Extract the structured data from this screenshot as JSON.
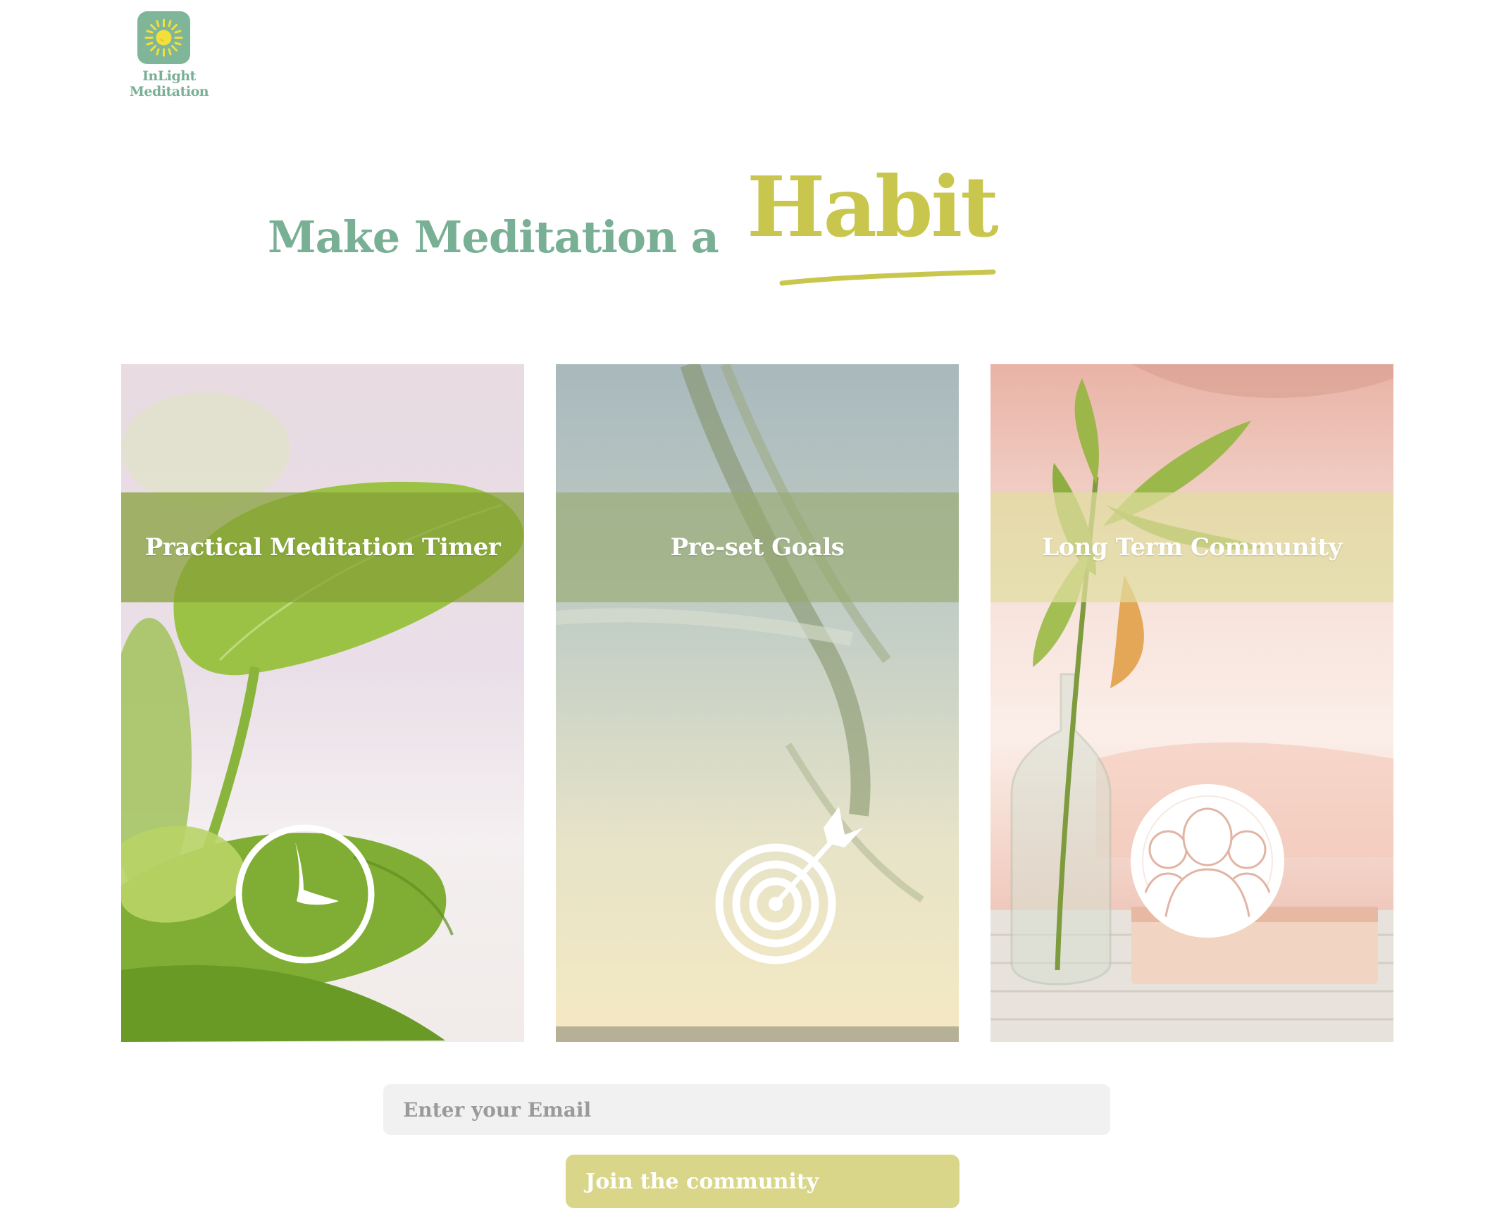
{
  "brand": {
    "name": "InLight Meditation",
    "logo_icon": "sun-icon",
    "logo_bg_color": "#7fb69a",
    "sun_color": "#f2df3a"
  },
  "hero": {
    "headline_plain": "Make Meditation a",
    "headline_accent": "Habit",
    "primary_color": "#79b095",
    "accent_color": "#c9c64e"
  },
  "features": [
    {
      "title": "Practical Meditation Timer",
      "icon": "clock-icon"
    },
    {
      "title": "Pre-set Goals",
      "icon": "target-icon"
    },
    {
      "title": "Long Term Community",
      "icon": "community-icon"
    }
  ],
  "signup": {
    "email_placeholder": "Enter your Email",
    "email_value": "",
    "button_label": "Join the community",
    "button_color": "#d9d589"
  }
}
